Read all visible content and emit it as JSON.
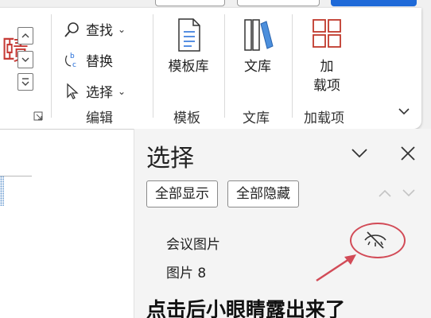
{
  "ribbon": {
    "editing_group": {
      "find_label": "查找",
      "replace_label": "替换",
      "select_label": "选择",
      "group_label": "编辑"
    },
    "template_group": {
      "button_label": "模板库",
      "group_label": "模板"
    },
    "library_group": {
      "button_label": "文库",
      "group_label": "文库"
    },
    "addins_group": {
      "button_label_line1": "加",
      "button_label_line2": "载项",
      "group_label": "加载项"
    }
  },
  "pane": {
    "title": "选择",
    "show_all_label": "全部显示",
    "hide_all_label": "全部隐藏",
    "items": [
      {
        "name": "会议图片",
        "visibility_icon": "eye-hidden-icon"
      },
      {
        "name": "图片 8"
      }
    ]
  },
  "annotation_text": "点击后小眼睛露出来了",
  "colors": {
    "highlight": "#d24b57",
    "accent_blue": "#1f6ad8"
  }
}
